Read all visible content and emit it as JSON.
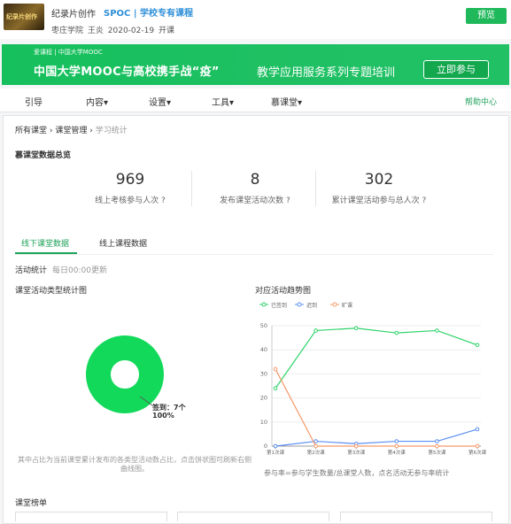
{
  "header": {
    "course_name": "纪录片创作",
    "course_type": "SPOC | 学校专有课程",
    "school": "枣庄学院",
    "teacher": "王炎",
    "date": "2020-02-19 开课",
    "thumb_text": "纪录片创作",
    "preview_label": "预览"
  },
  "banner": {
    "logo_text": "爱课程 | 中国大学MOOC",
    "title": "中国大学MOOC与高校携手战“疫”",
    "subtitle": "教学应用服务系列专题培训",
    "join_label": "立即参与"
  },
  "nav": {
    "items": [
      "引导",
      "内容▾",
      "设置▾",
      "工具▾",
      "慕课堂▾"
    ],
    "help": "帮助中心"
  },
  "breadcrumb": {
    "a": "所有课堂",
    "b": "课堂管理",
    "c": "学习统计"
  },
  "overview": {
    "title": "慕课堂数据总览",
    "stats": [
      {
        "value": "969",
        "label": "线上考核参与人次 ?"
      },
      {
        "value": "8",
        "label": "发布课堂活动次数 ?"
      },
      {
        "value": "302",
        "label": "累计课堂活动参与总人次 ?"
      }
    ]
  },
  "tabs": {
    "active": "线下课堂数据",
    "other": "线上课程数据"
  },
  "activity": {
    "label": "活动统计",
    "update": "每日00:00更新"
  },
  "donut": {
    "title": "课堂活动类型统计图",
    "label_line1": "签到：7个",
    "label_line2": "100%",
    "note": "其中占比为当前课堂累计发布的各类型活动数占比，点击饼状图可刷新右侧曲线图。",
    "color": "#12d95a"
  },
  "chart_data": {
    "type": "line",
    "title": "对应活动趋势图",
    "categories": [
      "第1次课",
      "第2次课",
      "第3次课",
      "第4次课",
      "第5次课",
      "第6次课"
    ],
    "ylim": [
      0,
      50
    ],
    "yticks": [
      0,
      10,
      20,
      30,
      40,
      50
    ],
    "grid": true,
    "legend_position": "top-left",
    "series": [
      {
        "name": "已签到",
        "color": "#2ed36a",
        "values": [
          24,
          48,
          49,
          47,
          48,
          42
        ]
      },
      {
        "name": "迟到",
        "color": "#5b8ff2",
        "values": [
          0,
          2,
          1,
          2,
          2,
          7
        ]
      },
      {
        "name": "旷课",
        "color": "#f59a6a",
        "values": [
          32,
          0,
          0,
          0,
          0,
          0
        ]
      }
    ],
    "note": "参与率=参与学生数量/总课堂人数，点名活动无参与率统计"
  },
  "rank": {
    "title": "课堂榜单"
  }
}
